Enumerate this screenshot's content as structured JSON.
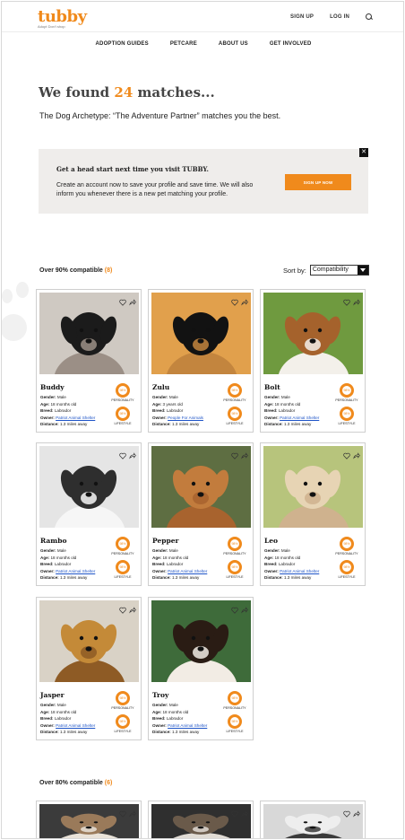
{
  "brand": {
    "name": "tubby",
    "tagline": "Adopt Don't shop"
  },
  "top_links": [
    "SIGN UP",
    "LOG IN"
  ],
  "nav": [
    "ADOPTION GUIDES",
    "PETCARE",
    "ABOUT US",
    "GET INVOLVED"
  ],
  "results": {
    "prefix": "We found",
    "count": "24",
    "suffix": "matches...",
    "archetype": "The Dog Archetype: “The Adventure Partner” matches you the best."
  },
  "banner": {
    "title": "Get a head start next time you visit TUBBY.",
    "text": "Create an account now to save your profile and save time. We will also inform you whenever there is a new pet matching your profile.",
    "button": "SIGN UP NOW",
    "close": "✕"
  },
  "section90": {
    "label": "Over 90% compatible",
    "count": "(8)"
  },
  "section80": {
    "label": "Over 80% compatible",
    "count": "(6)"
  },
  "sort": {
    "label": "Sort by:",
    "value": "Compatibility"
  },
  "labels": {
    "gender": "Gender:",
    "age": "Age:",
    "breed": "Breed:",
    "owner": "Owner:",
    "distance": "Distance:",
    "personality": "PERSONALITY",
    "lifestyle": "LIFESTYLE"
  },
  "dogs": [
    {
      "name": "Buddy",
      "gender": "Male",
      "age": "18 months old",
      "breed": "Labrador",
      "owner": "Patriot Animal Shelter",
      "distance": "1.3 miles away",
      "personality": "98%",
      "lifestyle": "98%",
      "palette": [
        "#cfc9c2",
        "#1b1b1b",
        "#9b8f86"
      ]
    },
    {
      "name": "Zulu",
      "gender": "Male",
      "age": "3 years old",
      "breed": "Labrador",
      "owner": "People For Animals",
      "distance": "1.3 miles away",
      "personality": "98%",
      "lifestyle": "98%",
      "palette": [
        "#e1a04c",
        "#121212",
        "#c3853e"
      ]
    },
    {
      "name": "Bolt",
      "gender": "Male",
      "age": "18 months old",
      "breed": "Labrador",
      "owner": "Patriot Animal Shelter",
      "distance": "1.3 miles away",
      "personality": "98%",
      "lifestyle": "98%",
      "palette": [
        "#6f9a3f",
        "#a5622c",
        "#f3f0ea"
      ]
    },
    {
      "name": "Rambo",
      "gender": "Male",
      "age": "18 months old",
      "breed": "Labrador",
      "owner": "Patriot Animal Shelter",
      "distance": "1.3 miles away",
      "personality": "98%",
      "lifestyle": "98%",
      "palette": [
        "#e5e5e5",
        "#2e2e2e",
        "#f6f6f6"
      ]
    },
    {
      "name": "Pepper",
      "gender": "Male",
      "age": "18 months old",
      "breed": "Labrador",
      "owner": "Patriot Animal Shelter",
      "distance": "1.3 miles away",
      "personality": "98%",
      "lifestyle": "98%",
      "palette": [
        "#5e6e42",
        "#c27c3d",
        "#a8632e"
      ]
    },
    {
      "name": "Leo",
      "gender": "Male",
      "age": "18 months old",
      "breed": "Labrador",
      "owner": "Patriot Animal Shelter",
      "distance": "1.3 miles away",
      "personality": "98%",
      "lifestyle": "98%",
      "palette": [
        "#b7c47c",
        "#e7d4b4",
        "#cfb28e"
      ]
    },
    {
      "name": "Jasper",
      "gender": "Male",
      "age": "18 months old",
      "breed": "Labrador",
      "owner": "Patriot Animal Shelter",
      "distance": "1.3 miles away",
      "personality": "98%",
      "lifestyle": "98%",
      "palette": [
        "#d9d2c6",
        "#c48a38",
        "#8e5b25"
      ]
    },
    {
      "name": "Troy",
      "gender": "Male",
      "age": "18 months old",
      "breed": "Labrador",
      "owner": "Patriot Animal Shelter",
      "distance": "1.3 miles away",
      "personality": "98%",
      "lifestyle": "98%",
      "palette": [
        "#3e6b3a",
        "#2a1c14",
        "#f2ece4"
      ]
    }
  ],
  "teasers": [
    {
      "palette": [
        "#3b3b3b",
        "#9a7a5a",
        "#e9e2d8"
      ]
    },
    {
      "palette": [
        "#2f2f2f",
        "#6a5a4a",
        "#e0dbd4"
      ]
    },
    {
      "palette": [
        "#d8d8d8",
        "#eeeeee",
        "#3a3a3a"
      ]
    }
  ]
}
